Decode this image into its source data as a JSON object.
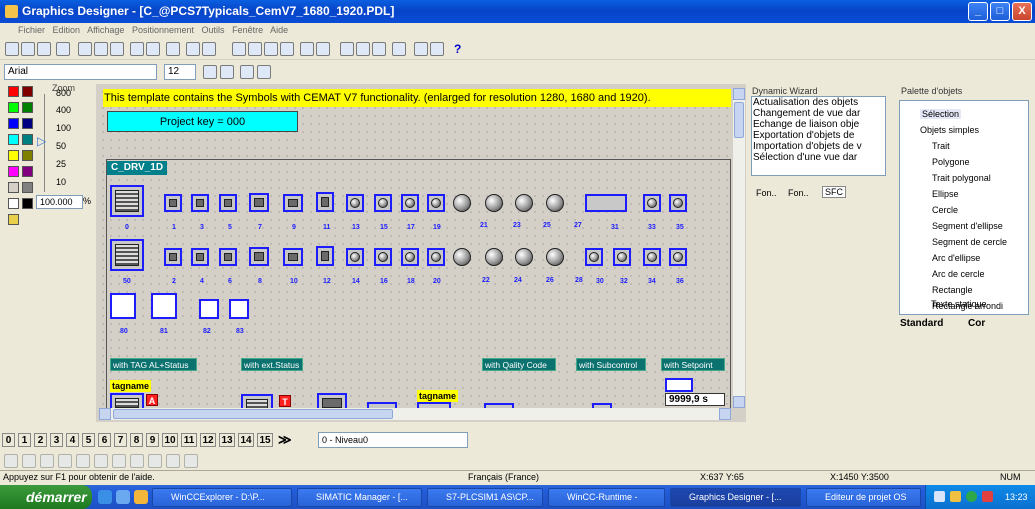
{
  "window": {
    "title": "Graphics Designer - [C_@PCS7Typicals_CemV7_1680_1920.PDL]",
    "minimize": "_",
    "maximize": "□",
    "close": "X"
  },
  "menu": [
    "Fichier",
    "Edition",
    "Affichage",
    "Positionnement",
    "Outils",
    "Fenêtre",
    "Aide"
  ],
  "font": {
    "name": "Arial",
    "size": "12",
    "zoom_value": "100.000"
  },
  "zoom": {
    "label": "Zoom",
    "levels": [
      "800",
      "400",
      "100",
      "50",
      "25",
      "10"
    ],
    "unit": "%"
  },
  "canvas": {
    "banner": "This template contains the Symbols with CEMAT V7 functionality. (enlarged for  resolution 1280, 1680 and 1920).",
    "project_key": "Project key = 000",
    "drv_label": "C_DRV_1D",
    "row1_nums": [
      "0",
      "1",
      "3",
      "5",
      "7",
      "9",
      "11",
      "13",
      "15",
      "17",
      "19",
      "21",
      "23",
      "25",
      "27",
      "31",
      "33",
      "35"
    ],
    "row2_nums": [
      "50",
      "2",
      "4",
      "6",
      "8",
      "10",
      "12",
      "14",
      "16",
      "18",
      "20",
      "22",
      "24",
      "26",
      "28",
      "30",
      "32",
      "34",
      "36"
    ],
    "row3_nums": [
      "80",
      "81",
      "82",
      "83"
    ],
    "buttons": [
      "with TAG  AL+Status",
      "with ext.Status",
      "with Qality Code",
      "with Subcontrol",
      "with Setpoint"
    ],
    "tagname1": "tagname",
    "tagname2": "tagname",
    "setpoint_value": "9999,9",
    "setpoint_unit": "s"
  },
  "dynamic_wizard": {
    "title": "Dynamic Wizard",
    "items": [
      "Actualisation des objets",
      "Changement de vue dar",
      "Echange de liaison obje",
      "Exportation d'objets de",
      "Importation d'objets de v",
      "Sélection d'une vue dar"
    ],
    "tabs": [
      "Fon..",
      "Fon..",
      "SFC"
    ]
  },
  "palette": {
    "title": "Palette d'objets",
    "items": [
      "Sélection",
      "Objets simples",
      "Trait",
      "Polygone",
      "Trait polygonal",
      "Ellipse",
      "Cercle",
      "Segment d'ellipse",
      "Segment de cercle",
      "Arc d'ellipse",
      "Arc de cercle",
      "Rectangle",
      "Rectangle arrondi",
      "Texte statique"
    ],
    "tabs": [
      "Standard",
      "Cor"
    ]
  },
  "layers": {
    "items": [
      "0",
      "1",
      "2",
      "3",
      "4",
      "5",
      "6",
      "7",
      "8",
      "9",
      "10",
      "11",
      "12",
      "13",
      "14",
      "15"
    ],
    "more": "≫",
    "level": "0 - Niveau0"
  },
  "status": {
    "help": "Appuyez sur F1 pour obtenir de l'aide.",
    "language": "Français (France)",
    "pos": "X:637 Y:65",
    "size": "X:1450 Y:3500",
    "num": "NUM"
  },
  "taskbar": {
    "start": "démarrer",
    "tasks": [
      "WinCCExplorer - D:\\P...",
      "SIMATIC Manager - [...",
      "S7-PLCSIM1  AS\\CP...",
      "WinCC-Runtime -",
      "Graphics Designer - [...",
      "Editeur de projet OS"
    ],
    "clock": "13:23"
  }
}
